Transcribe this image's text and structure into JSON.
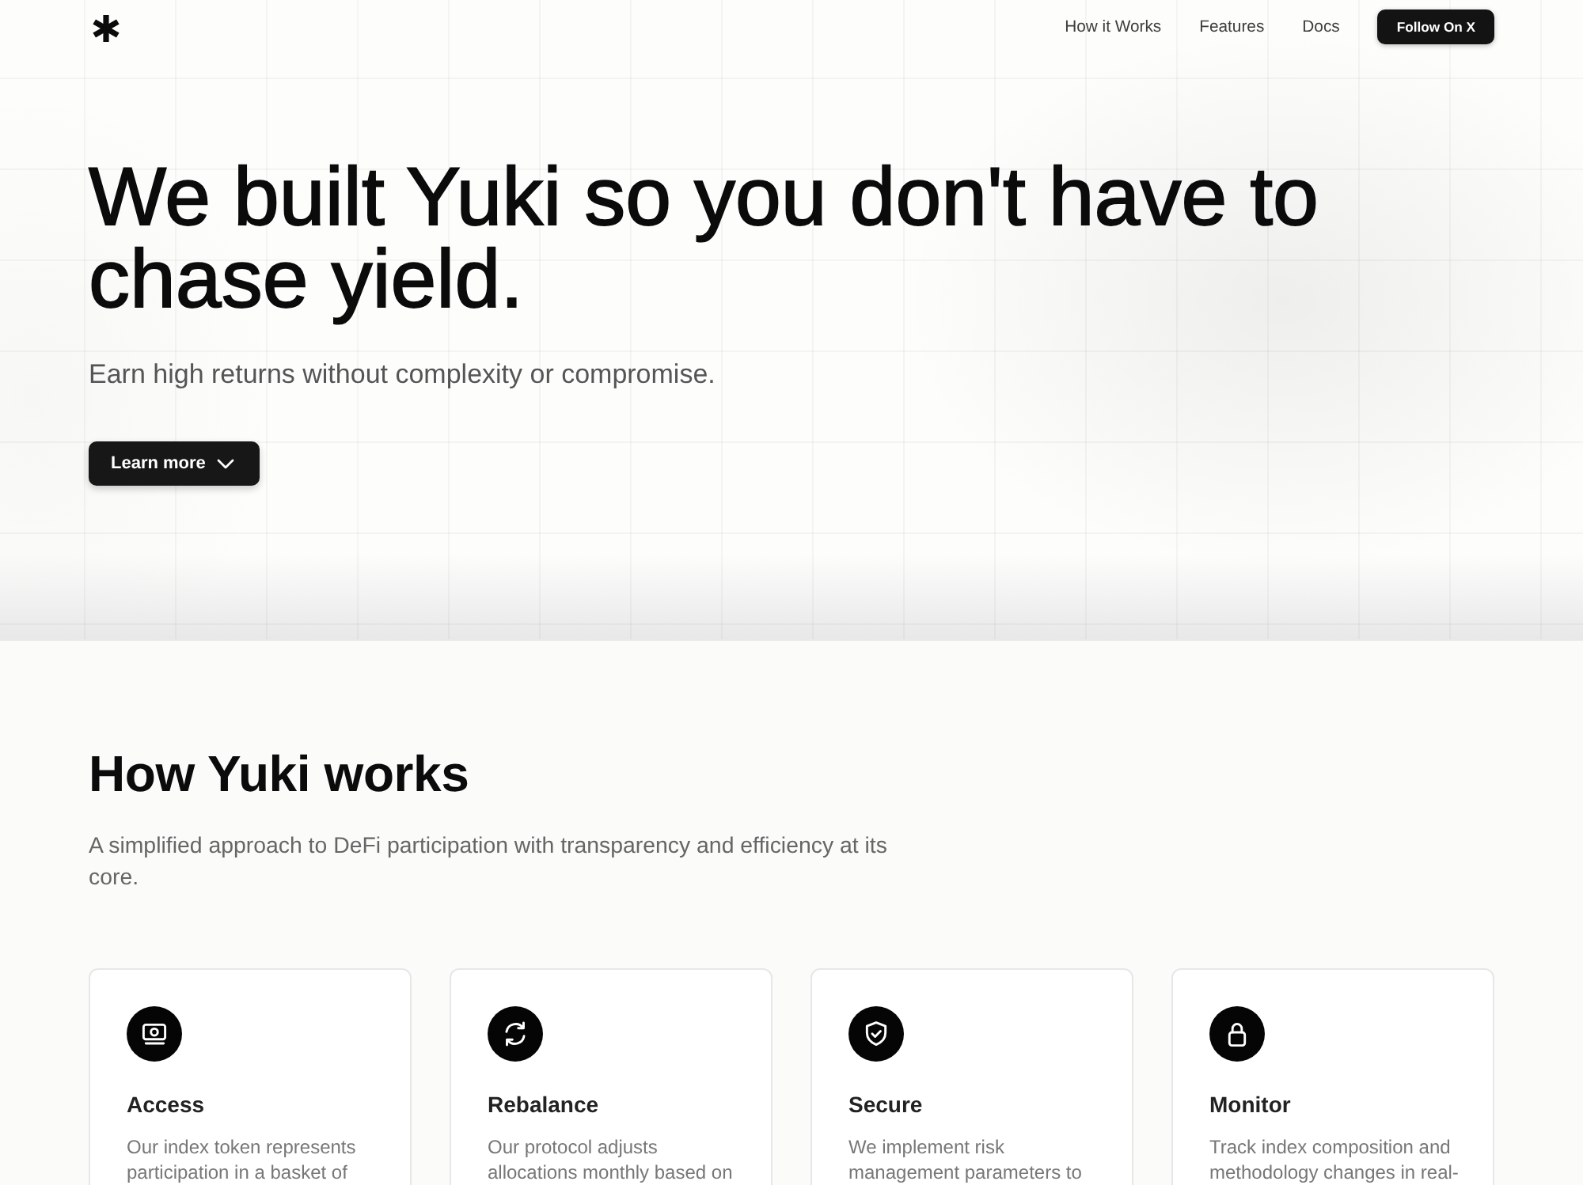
{
  "nav": {
    "links": [
      "How it Works",
      "Features",
      "Docs"
    ],
    "button": "Follow On X"
  },
  "hero": {
    "title": "We built Yuki so you don't have to chase yield.",
    "subtitle": "Earn high returns without complexity or compromise.",
    "button": "Learn more"
  },
  "how_it_works": {
    "title": "How Yuki works",
    "description": "A simplified approach to DeFi participation with transparency and efficiency at its core.",
    "cards": [
      {
        "title": "Access",
        "description": "Our index token represents participation in a basket of"
      },
      {
        "title": "Rebalance",
        "description": "Our protocol adjusts allocations monthly based on"
      },
      {
        "title": "Secure",
        "description": "We implement risk management parameters to"
      },
      {
        "title": "Monitor",
        "description": "Track index composition and methodology changes in real-"
      }
    ]
  }
}
